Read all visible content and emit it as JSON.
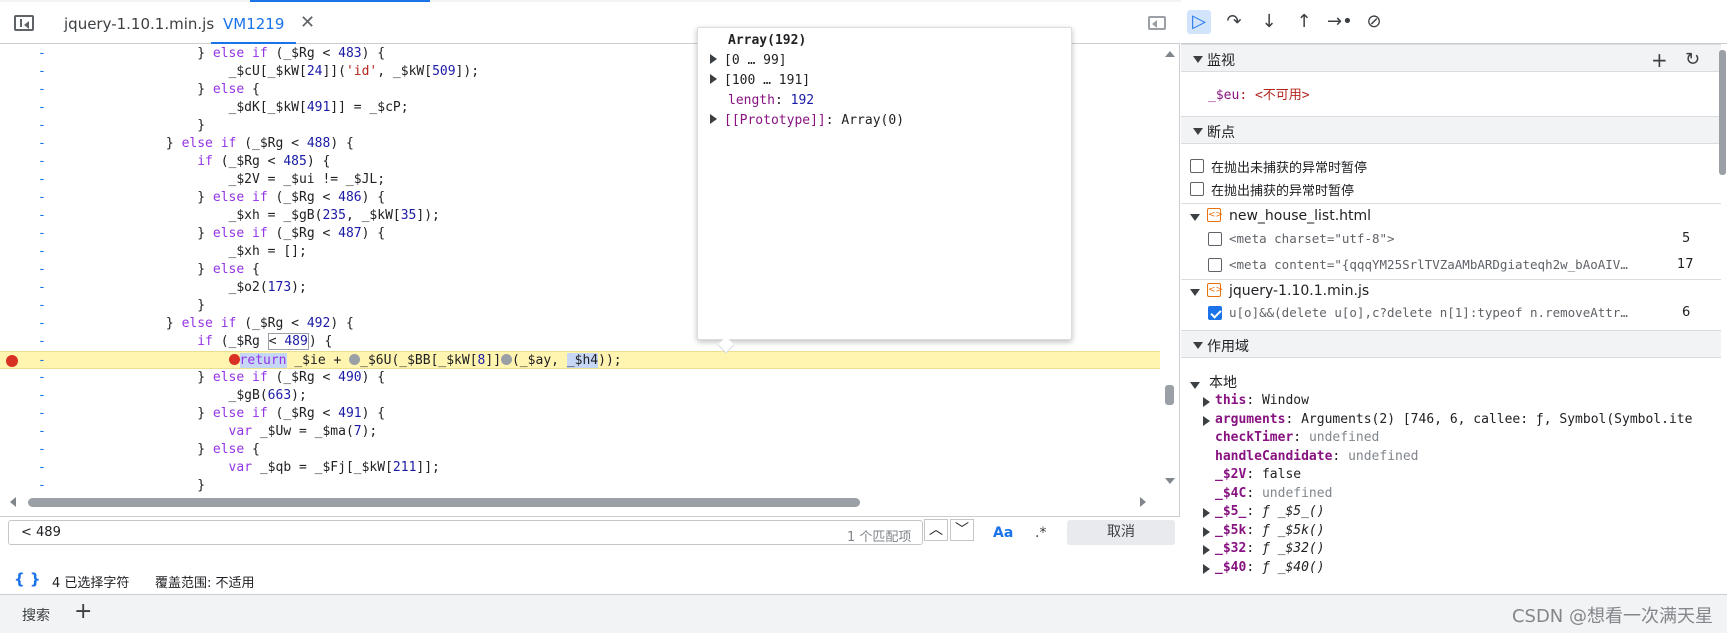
{
  "tabs": [
    {
      "label": "jquery-1.10.1.min.js"
    },
    {
      "label": "VM1219"
    }
  ],
  "code_lines": [
    {
      "g": "-",
      "html": "                } <span class=\"kw\">else if</span> (_$Rg &lt; <span class=\"num\">483</span>) {"
    },
    {
      "g": "-",
      "html": "                    _$cU[_$kW[<span class=\"num\">24</span>]](<span class=\"str\">'id'</span>, _$kW[<span class=\"num\">509</span>]);"
    },
    {
      "g": "-",
      "html": "                } <span class=\"kw\">else</span> {"
    },
    {
      "g": "-",
      "html": "                    _$dK[_$kW[<span class=\"num\">491</span>]] = _$cP;"
    },
    {
      "g": "-",
      "html": "                }"
    },
    {
      "g": "-",
      "html": "            } <span class=\"kw\">else if</span> (_$Rg &lt; <span class=\"num\">488</span>) {"
    },
    {
      "g": "-",
      "html": "                <span class=\"kw\">if</span> (_$Rg &lt; <span class=\"num\">485</span>) {"
    },
    {
      "g": "-",
      "html": "                    _$2V = _$ui != _$JL;"
    },
    {
      "g": "-",
      "html": "                } <span class=\"kw\">else if</span> (_$Rg &lt; <span class=\"num\">486</span>) {"
    },
    {
      "g": "-",
      "html": "                    _$xh = _$gB(<span class=\"num\">235</span>, _$kW[<span class=\"num\">35</span>]);"
    },
    {
      "g": "-",
      "html": "                } <span class=\"kw\">else if</span> (_$Rg &lt; <span class=\"num\">487</span>) {"
    },
    {
      "g": "-",
      "html": "                    _$xh = [];"
    },
    {
      "g": "-",
      "html": "                } <span class=\"kw\">else</span> {"
    },
    {
      "g": "-",
      "html": "                    _$o2(<span class=\"num\">173</span>);"
    },
    {
      "g": "-",
      "html": "                }"
    },
    {
      "g": "-",
      "html": "            } <span class=\"kw\">else if</span> (_$Rg &lt; <span class=\"num\">492</span>) {"
    },
    {
      "g": "-",
      "html": "                <span class=\"kw\">if</span> (_$Rg <span style=\"border:1px solid #9aa0a6\">&lt; <span class=\"num\">489</span></span>) {"
    },
    {
      "g": "-",
      "bp": true,
      "hl": true,
      "html": "                    <span class=\"inbp red\"></span><span class=\"sel kw\">return</span> _$ie + <span class=\"inbp grey\"></span>_$6U(_$BB[_$kW[<span class=\"num\">8</span>]]<span class=\"inbp grey\"></span>(_$ay, <span class=\"sel\">_$h4</span>));"
    },
    {
      "g": "-",
      "html": "                } <span class=\"kw\">else if</span> (_$Rg &lt; <span class=\"num\">490</span>) {"
    },
    {
      "g": "-",
      "html": "                    _$gB(<span class=\"num\">663</span>);"
    },
    {
      "g": "-",
      "html": "                } <span class=\"kw\">else if</span> (_$Rg &lt; <span class=\"num\">491</span>) {"
    },
    {
      "g": "-",
      "html": "                    <span class=\"kw\">var</span> _$Uw = _$ma(<span class=\"num\">7</span>);"
    },
    {
      "g": "-",
      "html": "                } <span class=\"kw\">else</span> {"
    },
    {
      "g": "-",
      "html": "                    <span class=\"kw\">var</span> _$qb = _$Fj[_$kW[<span class=\"num\">211</span>]];"
    },
    {
      "g": "-",
      "html": "                }"
    }
  ],
  "popover": {
    "title": "Array(192)",
    "range1": "[0 … 99]",
    "range2": "[100 … 191]",
    "length_key": "length",
    "length_val": "192",
    "proto_key": "[[Prototype]]",
    "proto_val": "Array(0)"
  },
  "search": {
    "value": "< 489",
    "match_count": "1 个匹配项",
    "case_label": "Aa",
    "regex_label": ".*",
    "cancel_label": "取消"
  },
  "status": {
    "braces": "{ }",
    "selection": "4 已选择字符",
    "coverage": "覆盖范围: 不适用"
  },
  "drawer": {
    "search_tab": "搜索",
    "plus": "+",
    "watermark": "CSDN @想看一次满天星"
  },
  "sidebar": {
    "watch_title": "监视",
    "watch_entry_key": "_$eu",
    "watch_entry_val": "<不可用>",
    "breakpoints_title": "断点",
    "pause_uncaught": "在抛出未捕获的异常时暂停",
    "pause_caught": "在抛出捕获的异常时暂停",
    "bp_groups": [
      {
        "file": "new_house_list.html",
        "items": [
          {
            "code": "<meta charset=\"utf-8\">",
            "line": "5",
            "checked": false
          },
          {
            "code": "<meta content=\"{qqqYM25SrlTVZaAMbARDgiateqh2w_bAoAIV…",
            "line": "17",
            "checked": false
          }
        ]
      },
      {
        "file": "jquery-1.10.1.min.js",
        "items": [
          {
            "code": "u[o]&&(delete u[o],c?delete n[1]:typeof n.removeAttr…",
            "line": "6",
            "checked": true
          }
        ]
      }
    ],
    "scope_title": "作用域",
    "local_title": "本地",
    "scope_items": [
      {
        "key": "this",
        "val": "Window",
        "expand": true,
        "cls": "sv"
      },
      {
        "key": "arguments",
        "val": "Arguments(2) [746, 6, callee: ƒ, Symbol(Symbol.ite",
        "expand": true,
        "cls": "sv"
      },
      {
        "key": "checkTimer",
        "val": "undefined",
        "expand": false,
        "cls": "undef"
      },
      {
        "key": "handleCandidate",
        "val": "undefined",
        "expand": false,
        "cls": "undef"
      },
      {
        "key": "_$2V",
        "val": "false",
        "expand": false,
        "cls": "sv"
      },
      {
        "key": "_$4C",
        "val": "undefined",
        "expand": false,
        "cls": "undef"
      },
      {
        "key": "_$5_",
        "val": "ƒ _$5_()",
        "expand": true,
        "cls": "fn"
      },
      {
        "key": "_$5k",
        "val": "ƒ _$5k()",
        "expand": true,
        "cls": "fn"
      },
      {
        "key": "_$32",
        "val": "ƒ _$32()",
        "expand": true,
        "cls": "fn"
      },
      {
        "key": "_$40",
        "val": "ƒ _$40()",
        "expand": true,
        "cls": "fn"
      }
    ]
  }
}
